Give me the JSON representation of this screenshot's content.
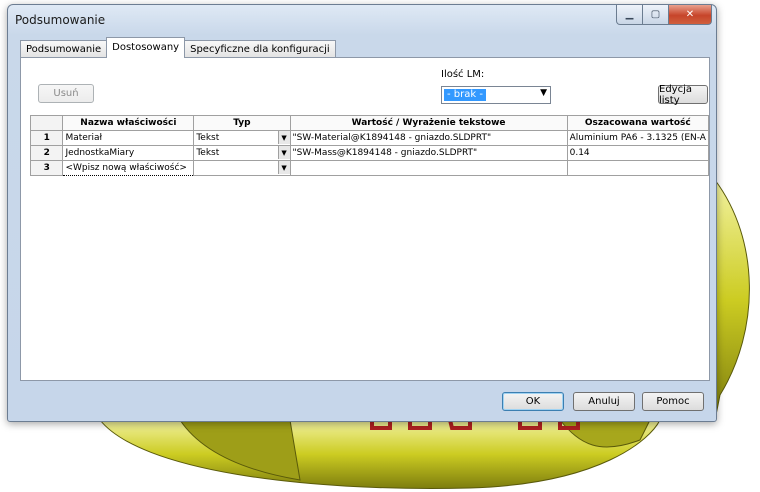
{
  "window": {
    "title": "Podsumowanie",
    "minimize_icon": "minimize-icon",
    "maximize_icon": "maximize-icon",
    "close_icon": "close-icon"
  },
  "tabs": [
    {
      "label": "Podsumowanie",
      "active": false
    },
    {
      "label": "Dostosowany",
      "active": true
    },
    {
      "label": "Specyficzne dla konfiguracji",
      "active": false
    }
  ],
  "toolbar": {
    "delete_label": "Usuń",
    "lm_label": "Ilość LM:",
    "lm_value": "- brak -",
    "edit_list_label": "Edycja listy"
  },
  "grid": {
    "columns": [
      "Nazwa właściwości",
      "Typ",
      "Wartość / Wyrażenie tekstowe",
      "Oszacowana wartość"
    ],
    "rows": [
      {
        "num": "1",
        "name": "Materiał",
        "type": "Tekst",
        "value": "\"SW-Material@K1894148 - gniazdo.SLDPRT\"",
        "evaluated": "Aluminium PA6 - 3.1325 (EN-A"
      },
      {
        "num": "2",
        "name": "JednostkaMiary",
        "type": "Tekst",
        "value": "\"SW-Mass@K1894148 - gniazdo.SLDPRT\"",
        "evaluated": "0.14"
      },
      {
        "num": "3",
        "name": "<Wpisz nową właściwość>",
        "type": "",
        "value": "",
        "evaluated": ""
      }
    ]
  },
  "buttons": {
    "ok": "OK",
    "cancel": "Anuluj",
    "help": "Pomoc"
  },
  "colors": {
    "model_yellow": "#c8c81a",
    "model_text_red": "#b02020",
    "selection_blue": "#3399ff"
  }
}
